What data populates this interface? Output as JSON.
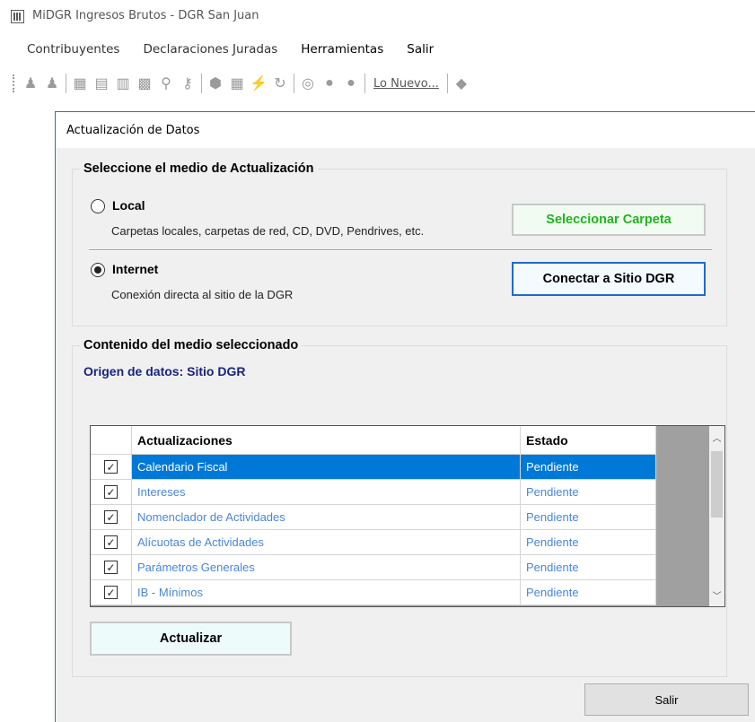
{
  "app": {
    "title": "MiDGR Ingresos Brutos - DGR San Juan"
  },
  "menu": [
    {
      "label": "Contribuyentes"
    },
    {
      "label": "Declaraciones Juradas"
    },
    {
      "label": "Herramientas"
    },
    {
      "label": "Salir"
    }
  ],
  "toolbar": {
    "icons": [
      "users-icon",
      "users-icon",
      "calculator-icon",
      "book-icon",
      "form-icon",
      "table-icon",
      "search-icon",
      "key-icon",
      "gem-icon",
      "calendar-icon",
      "lightning-icon",
      "refresh-icon",
      "fingerprint-icon",
      "help-icon",
      "record-icon",
      "chat-icon"
    ],
    "lo_nuevo": "Lo Nuevo..."
  },
  "dialog": {
    "title": "Actualización de Datos",
    "medio_group": {
      "legend": "Seleccione el medio de Actualización",
      "local": {
        "label": "Local",
        "description": "Carpetas locales, carpetas de red, CD, DVD, Pendrives, etc.",
        "checked": false,
        "button": "Seleccionar Carpeta"
      },
      "internet": {
        "label": "Internet",
        "description": "Conexión directa al sitio de la DGR",
        "checked": true,
        "button": "Conectar a Sitio DGR"
      }
    },
    "contenido_group": {
      "legend": "Contenido del medio seleccionado",
      "origen": "Origen de datos: Sitio DGR"
    },
    "grid": {
      "columns": [
        "Actualizaciones",
        "Estado"
      ],
      "rows": [
        {
          "name": "Calendario Fiscal",
          "status": "Pendiente",
          "checked": true,
          "selected": true
        },
        {
          "name": "Intereses",
          "status": "Pendiente",
          "checked": true,
          "selected": false
        },
        {
          "name": "Nomenclador de Actividades",
          "status": "Pendiente",
          "checked": true,
          "selected": false
        },
        {
          "name": "Alícuotas de Actividades",
          "status": "Pendiente",
          "checked": true,
          "selected": false
        },
        {
          "name": "Parámetros Generales",
          "status": "Pendiente",
          "checked": true,
          "selected": false
        },
        {
          "name": "IB - Mínimos",
          "status": "Pendiente",
          "checked": true,
          "selected": false
        }
      ]
    },
    "actualizar_button": "Actualizar",
    "salir_button": "Salir"
  },
  "colors": {
    "selection": "#0078d7",
    "link_blue": "#4a86d8",
    "origen_navy": "#1a237e",
    "seleccionar_green": "#1fb51f",
    "conectar_border": "#1d6cc8"
  }
}
